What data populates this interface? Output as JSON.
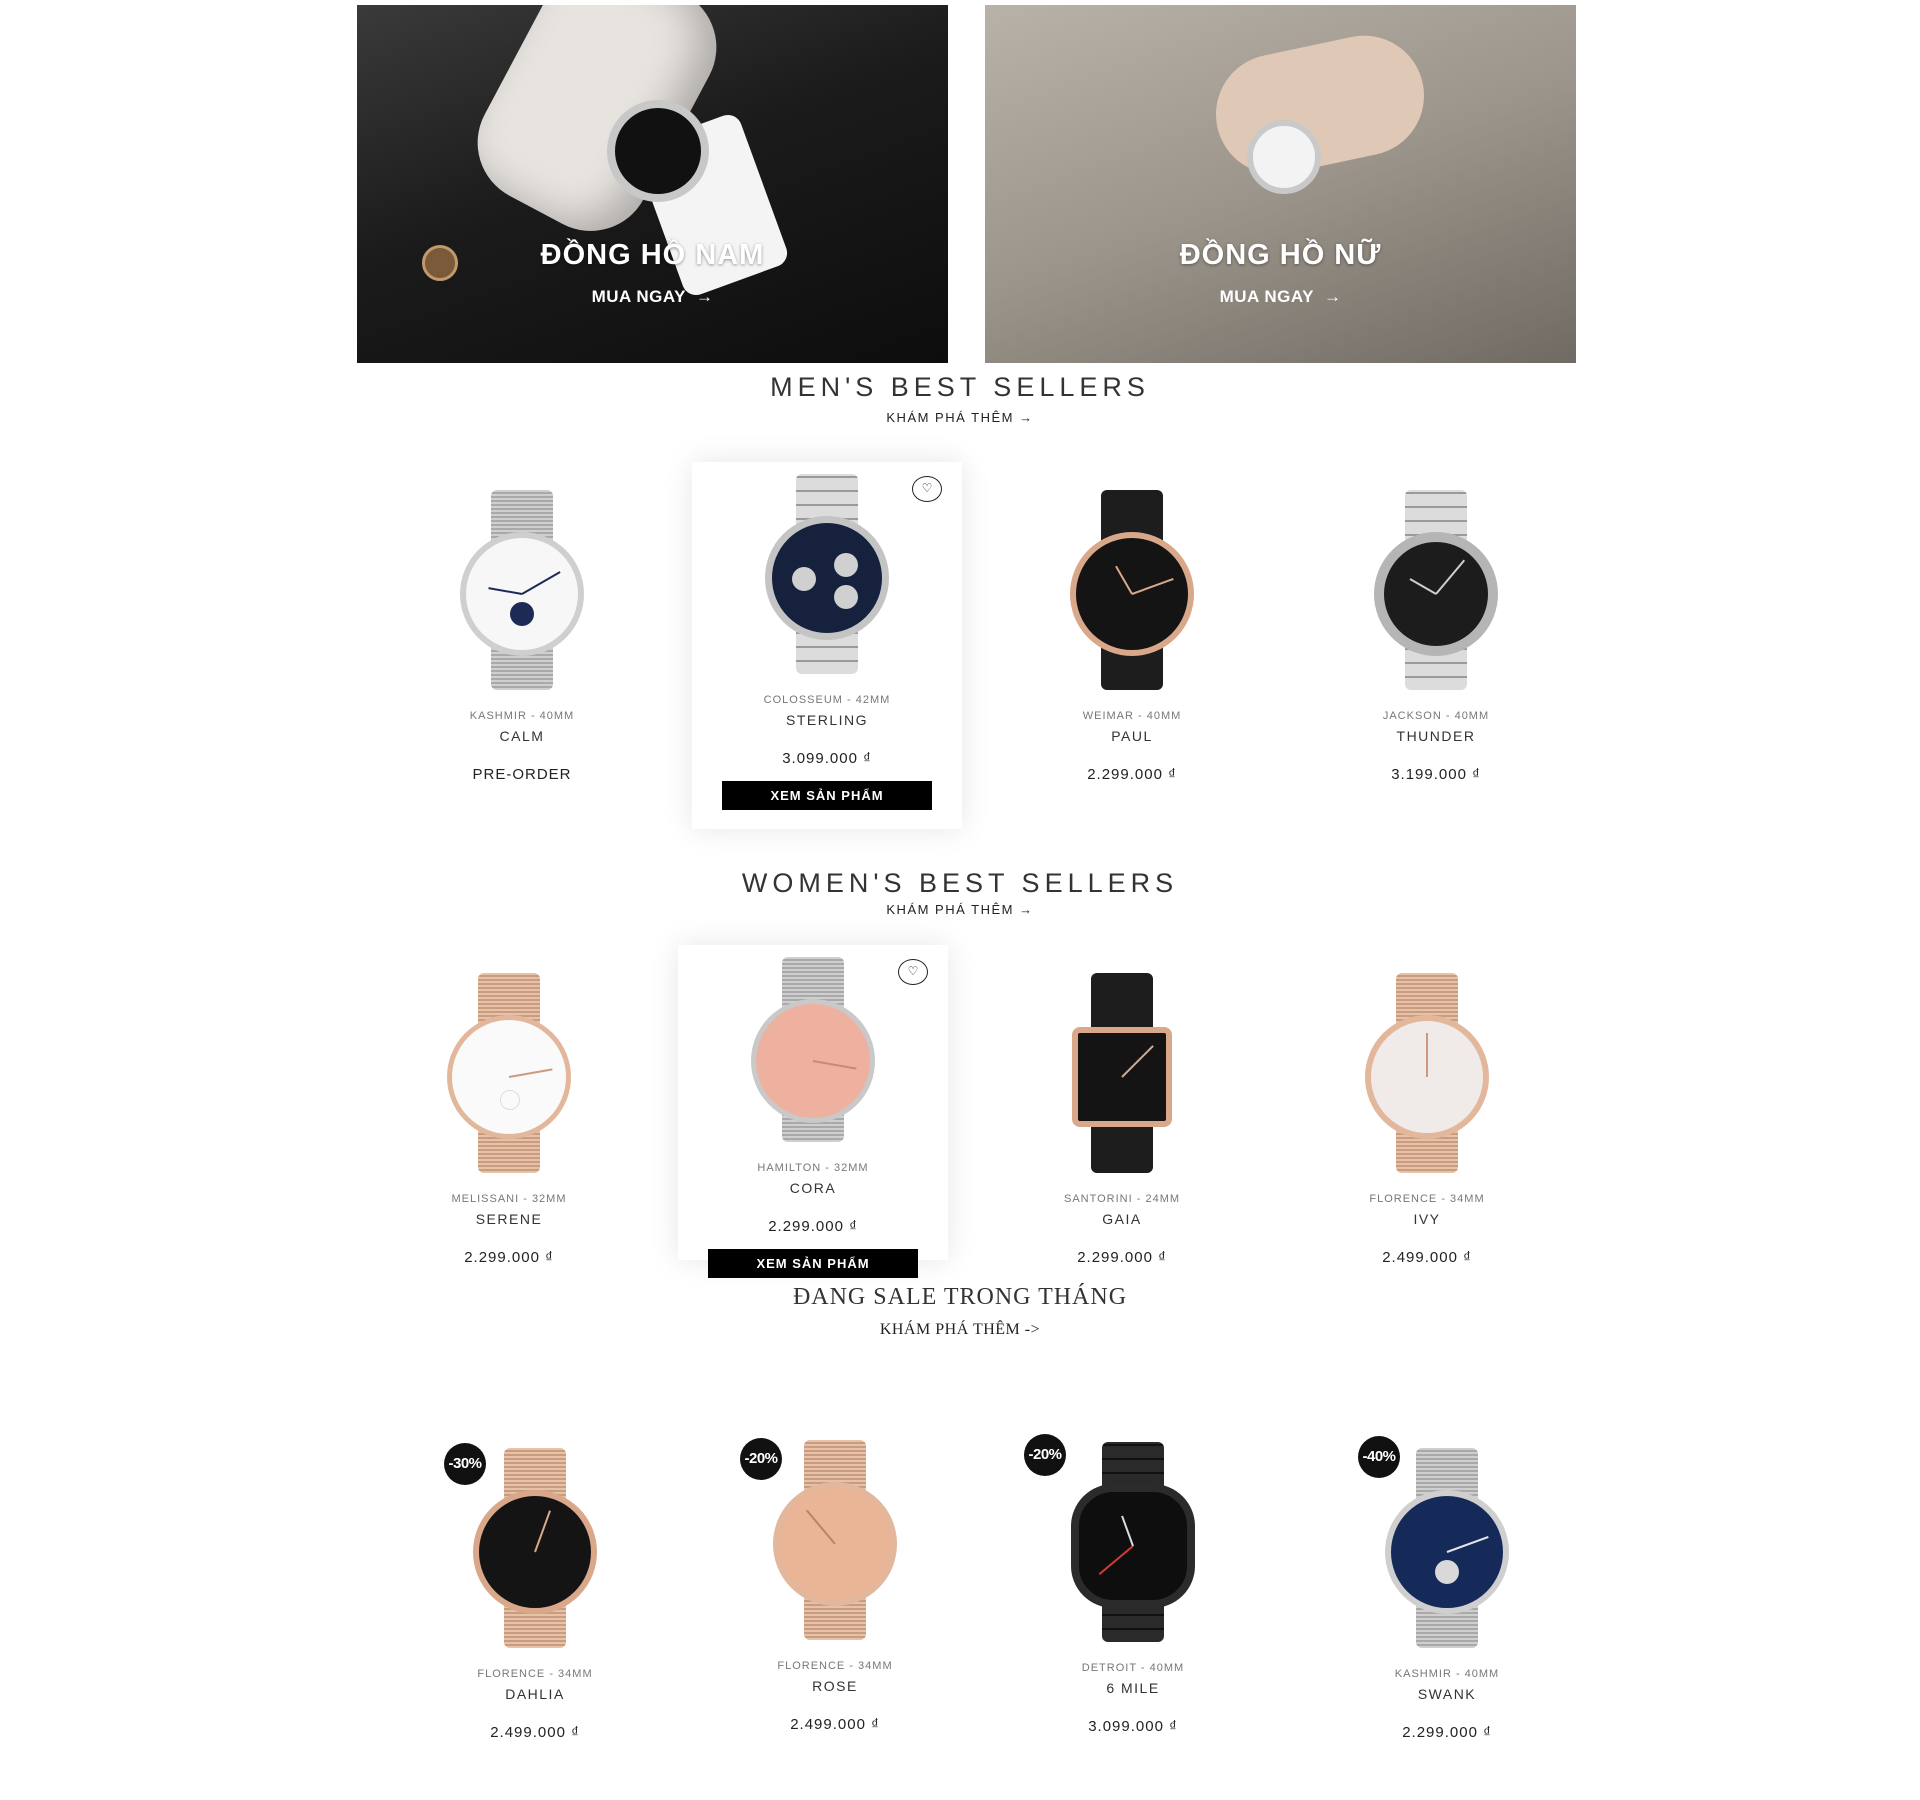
{
  "banners": [
    {
      "title": "ĐỒNG HỒ NAM",
      "cta": "MUA NGAY",
      "arrow": "→"
    },
    {
      "title": "ĐỒNG HỒ NỮ",
      "cta": "MUA NGAY",
      "arrow": "→"
    }
  ],
  "mens": {
    "title": "MEN'S BEST SELLERS",
    "link": "KHÁM PHÁ THÊM →",
    "products": [
      {
        "sub": "KASHMIR - 40MM",
        "name": "CALM",
        "price": "PRE-ORDER"
      },
      {
        "sub": "COLOSSEUM - 42MM",
        "name": "STERLING",
        "price": "3.099.000 ₫",
        "button": "XEM SẢN PHẨM"
      },
      {
        "sub": "WEIMAR - 40MM",
        "name": "PAUL",
        "price": "2.299.000 ₫"
      },
      {
        "sub": "JACKSON - 40MM",
        "name": "THUNDER",
        "price": "3.199.000 ₫"
      }
    ]
  },
  "womens": {
    "title": "WOMEN'S BEST SELLERS",
    "link": "KHÁM PHÁ THÊM →",
    "products": [
      {
        "sub": "MELISSANI - 32MM",
        "name": "SERENE",
        "price": "2.299.000 ₫"
      },
      {
        "sub": "HAMILTON - 32MM",
        "name": "CORA",
        "price": "2.299.000 ₫",
        "button": "XEM SẢN PHẨM"
      },
      {
        "sub": "SANTORINI - 24MM",
        "name": "GAIA",
        "price": "2.299.000 ₫"
      },
      {
        "sub": "FLORENCE - 34MM",
        "name": "IVY",
        "price": "2.499.000 ₫"
      }
    ]
  },
  "sale": {
    "title": "ĐANG SALE TRONG THÁNG",
    "link": "KHÁM PHÁ THÊM ->",
    "products": [
      {
        "badge": "-30%",
        "sub": "FLORENCE - 34MM",
        "name": "DAHLIA",
        "price": "2.499.000 ₫"
      },
      {
        "badge": "-20%",
        "sub": "FLORENCE - 34MM",
        "name": "ROSE",
        "price": "2.499.000 ₫"
      },
      {
        "badge": "-20%",
        "sub": "DETROIT - 40MM",
        "name": "6 MILE",
        "price": "3.099.000 ₫"
      },
      {
        "badge": "-40%",
        "sub": "KASHMIR - 40MM",
        "name": "SWANK",
        "price": "2.299.000 ₫"
      }
    ]
  },
  "icons": {
    "wishlist": "heart-icon",
    "arrow": "arrow-right-icon"
  },
  "colors": {
    "button_bg": "#000000",
    "badge_bg": "#111111",
    "text": "#222222"
  }
}
